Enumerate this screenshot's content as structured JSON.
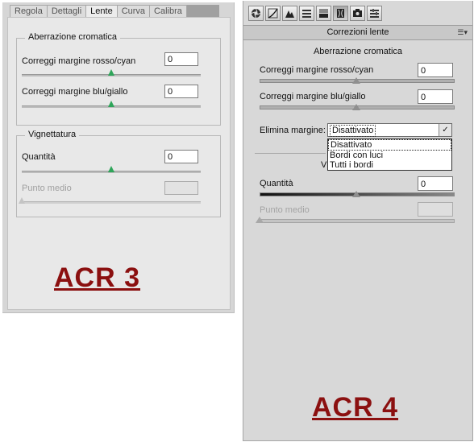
{
  "acr3": {
    "tabs": [
      "Regola",
      "Dettagli",
      "Lente",
      "Curva",
      "Calibra"
    ],
    "active_tab": "Lente",
    "chromatic_group": "Aberrazione cromatica",
    "red_cyan_label": "Correggi margine rosso/cyan",
    "red_cyan_value": "0",
    "blue_yellow_label": "Correggi margine blu/giallo",
    "blue_yellow_value": "0",
    "vignetting_group": "Vignettatura",
    "amount_label": "Quantità",
    "amount_value": "0",
    "midpoint_label": "Punto medio",
    "midpoint_value": "",
    "caption": "ACR 3"
  },
  "acr4": {
    "toolbar_icons": [
      "aperture-icon",
      "curve-icon",
      "sharpen-icon",
      "hsl-icon",
      "split-tone-icon",
      "lens-icon",
      "camera-icon",
      "presets-icon"
    ],
    "active_tool": "lens-icon",
    "panel_title": "Correzioni lente",
    "chromatic_group": "Aberrazione cromatica",
    "red_cyan_label": "Correggi margine rosso/cyan",
    "red_cyan_value": "0",
    "blue_yellow_label": "Correggi margine blu/giallo",
    "blue_yellow_value": "0",
    "defringe_label": "Elimina margine:",
    "defringe_value": "Disattivato",
    "defringe_options": [
      "Disattivato",
      "Bordi con luci",
      "Tutti i bordi"
    ],
    "vignetting_partial": "V",
    "amount_label": "Quantità",
    "amount_value": "0",
    "midpoint_label": "Punto medio",
    "midpoint_value": "",
    "caption": "ACR 4"
  }
}
